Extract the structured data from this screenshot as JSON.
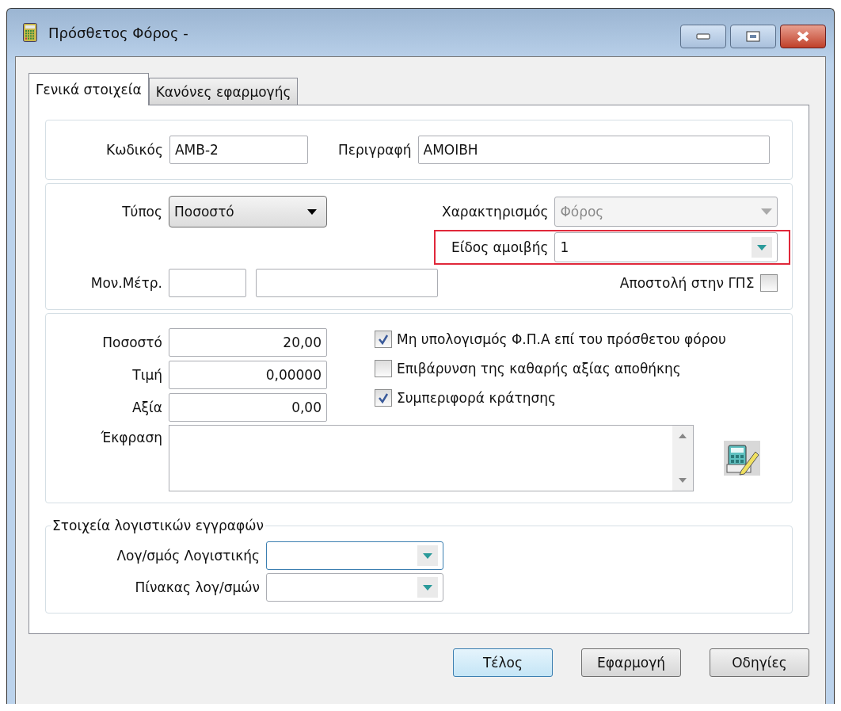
{
  "window": {
    "title": "Πρόσθετος Φόρος -"
  },
  "tabs": [
    {
      "label": "Γενικά στοιχεία",
      "selected": true
    },
    {
      "label": "Κανόνες εφαρμογής",
      "selected": false
    }
  ],
  "header": {
    "code": {
      "label": "Κωδικός",
      "value": "AMB-2"
    },
    "description": {
      "label": "Περιγραφή",
      "value": "AMOIBH"
    }
  },
  "type_section": {
    "type": {
      "label": "Τύπος",
      "value": "Ποσοστό"
    },
    "characterization": {
      "label": "Χαρακτηρισμός",
      "value": "Φόρος",
      "disabled": true
    },
    "fee_kind": {
      "label": "Είδος αμοιβής",
      "value": "1",
      "highlighted": true
    },
    "unit": {
      "label": "Μον.Μέτρ."
    },
    "send_to_gps": {
      "label": "Αποστολή στην ΓΠΣ",
      "checked": false
    }
  },
  "values_section": {
    "fields": [
      {
        "label": "Ποσοστό",
        "value": "20,00"
      },
      {
        "label": "Τιμή",
        "value": "0,00000"
      },
      {
        "label": "Αξία",
        "value": "0,00"
      }
    ],
    "options": [
      {
        "label": "Μη υπολογισμός Φ.Π.Α επί του πρόσθετου φόρου",
        "checked": true
      },
      {
        "label": "Επιβάρυνση της καθαρής αξίας αποθήκης",
        "checked": false
      },
      {
        "label": "Συμπεριφορά κράτησης",
        "checked": true
      }
    ],
    "expression": {
      "label": "Έκφραση"
    }
  },
  "accounting": {
    "title": "Στοιχεία λογιστικών εγγραφών",
    "fields": [
      {
        "label": "Λογ/σμός Λογιστικής",
        "focused": true
      },
      {
        "label": "Πίνακας λογ/σμών",
        "focused": false
      }
    ]
  },
  "buttons": [
    {
      "label": "Τέλος",
      "default": true
    },
    {
      "label": "Εφαρμογή",
      "default": false
    },
    {
      "label": "Οδηγίες",
      "default": false
    }
  ]
}
